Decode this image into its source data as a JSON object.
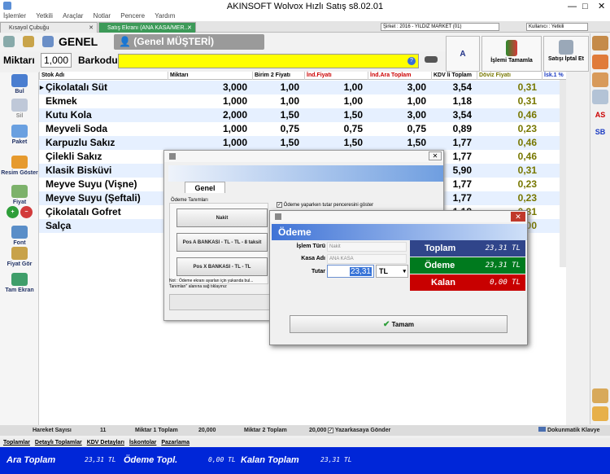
{
  "window": {
    "title": "AKINSOFT Wolvox Hızlı Satış s8.02.01"
  },
  "menu": [
    "İşlemler",
    "Yetkili",
    "Araçlar",
    "Notlar",
    "Pencere",
    "Yardım"
  ],
  "tabs": [
    {
      "label": "Kısayol Çubuğu"
    },
    {
      "label": "Satış Ekranı (ANA KASA/MER..."
    }
  ],
  "info": {
    "company": "Şirket : 2016 - YILDIZ MARKET (01)",
    "user": "Kullanıcı : Yetkili"
  },
  "header": {
    "price_group": "GENEL",
    "customer": "(Genel MÜŞTERİ)"
  },
  "entry": {
    "qty_label": "Miktarı",
    "qty_value": "1,000",
    "barcode_label": "Barkodu",
    "barcode_value": ""
  },
  "top_buttons": {
    "a": "A",
    "complete": "İşlemi Tamamla",
    "cancel": "Satışı İptal Et"
  },
  "left_buttons": [
    "Bul",
    "Sil",
    "Paket",
    "Resim Göster",
    "Fiyat",
    "Font",
    "Fiyat Gör",
    "Tam Ekran"
  ],
  "right_buttons": {
    "as": "AS",
    "sb": "SB"
  },
  "grid": {
    "headers": [
      "Stok Adı",
      "Miktarı",
      "Birim 2 Fiyatı",
      "İnd.Fiyatı",
      "İnd.Ara Toplam",
      "KDV li Toplam",
      "Döviz Fiyatı",
      "İsk.1 %"
    ],
    "rows": [
      {
        "name": "Çikolatalı Süt",
        "qty": "3,000",
        "price": "1,00",
        "disc": "1,00",
        "sub": "3,00",
        "kdv": "3,54",
        "fx": "0,31"
      },
      {
        "name": "Ekmek",
        "qty": "1,000",
        "price": "1,00",
        "disc": "1,00",
        "sub": "1,00",
        "kdv": "1,18",
        "fx": "0,31"
      },
      {
        "name": "Kutu Kola",
        "qty": "2,000",
        "price": "1,50",
        "disc": "1,50",
        "sub": "3,00",
        "kdv": "3,54",
        "fx": "0,46"
      },
      {
        "name": "Meyveli Soda",
        "qty": "1,000",
        "price": "0,75",
        "disc": "0,75",
        "sub": "0,75",
        "kdv": "0,89",
        "fx": "0,23"
      },
      {
        "name": "Karpuzlu Sakız",
        "qty": "1,000",
        "price": "1,50",
        "disc": "1,50",
        "sub": "1,50",
        "kdv": "1,77",
        "fx": "0,46"
      },
      {
        "name": "Çilekli Sakız",
        "qty": "",
        "price": "",
        "disc": "",
        "sub": "",
        "kdv": "1,77",
        "fx": "0,46"
      },
      {
        "name": "Klasik Bisküvi",
        "qty": "",
        "price": "",
        "disc": "",
        "sub": "",
        "kdv": "5,90",
        "fx": "0,31"
      },
      {
        "name": "Meyve Suyu (Vişne)",
        "qty": "",
        "price": "",
        "disc": "",
        "sub": "",
        "kdv": "1,77",
        "fx": "0,23"
      },
      {
        "name": "Meyve Suyu (Şeftali)",
        "qty": "",
        "price": "",
        "disc": "",
        "sub": "",
        "kdv": "1,77",
        "fx": "0,23"
      },
      {
        "name": "Çikolatalı Gofret",
        "qty": "",
        "price": "",
        "disc": "",
        "sub": "",
        "kdv": "1,18",
        "fx": "0,31"
      },
      {
        "name": "Salça",
        "qty": "",
        "price": "",
        "disc": "",
        "sub": "",
        "kdv": "",
        "fx": "00"
      }
    ]
  },
  "settings_dialog": {
    "tab": "Genel",
    "group": "Ödeme Tanımları",
    "payments": [
      "Nakit",
      "Pos A BANKASI - TL - TL - 8 taksit",
      "Pos X BANKASI - TL - TL"
    ],
    "checkbox": "Ödeme yaparken tutar penceresini göster",
    "note": "Not : Ödeme ekranı ayarları için yukarıda bul... Tanımları\" alanına sağ tıklayınız"
  },
  "payment_dialog": {
    "title": "Ödeme",
    "type_label": "İşlem Türü",
    "type_value": "Nakit",
    "register_label": "Kasa Adı",
    "register_value": "ANA KASA",
    "amount_label": "Tutar",
    "amount_value": "23,31",
    "currency": "TL",
    "total_label": "Toplam",
    "total_value": "23,31 TL",
    "paid_label": "Ödeme",
    "paid_value": "23,31 TL",
    "rest_label": "Kalan",
    "rest_value": "0,00 TL",
    "ok_label": "Tamam"
  },
  "status": {
    "moves_label": "Hareket Sayısı",
    "moves": "11",
    "qty1_label": "Miktar 1 Toplam",
    "qty1": "20,000",
    "qty2_label": "Miktar 2 Toplam",
    "qty2": "20,000",
    "send_label": "Yazarkasaya Gönder",
    "keyboard_label": "Dokunmatik Klavye"
  },
  "sub_tabs": [
    "Toplamlar",
    "Detaylı Toplamlar",
    "KDV Detayları",
    "İskontolar",
    "Pazarlama"
  ],
  "totals": {
    "sub_label": "Ara Toplam",
    "sub": "23,31 TL",
    "paid_label": "Ödeme Topl.",
    "paid": "0,00 TL",
    "rest_label": "Kalan Toplam",
    "rest": "23,31 TL"
  },
  "colors": {
    "accent_green": "#3c9a58",
    "total_blue": "#0026d8",
    "paid_green": "#007a1e",
    "rest_red": "#c80000"
  }
}
